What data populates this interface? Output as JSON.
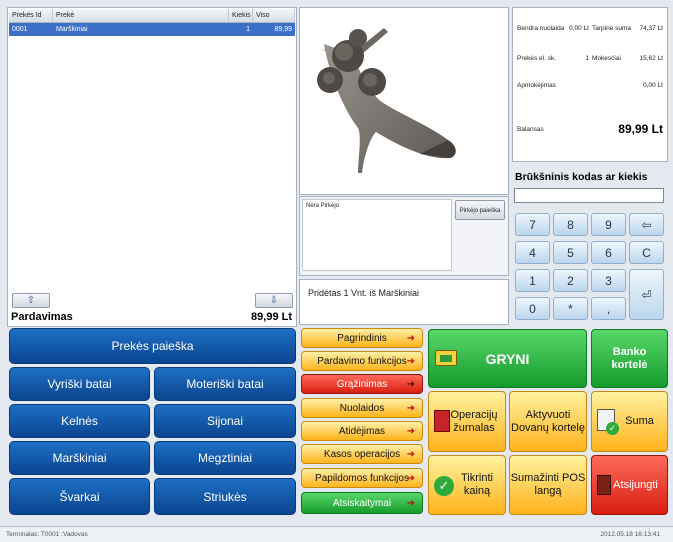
{
  "cart": {
    "columns": [
      "Prekės Id",
      "Prekė",
      "Kiekis",
      "Viso"
    ],
    "rows": [
      [
        "0001",
        "Marškiniai",
        "1",
        "89,99"
      ]
    ],
    "scroll_up": "⇧",
    "scroll_down": "⇩",
    "mode_label": "Pardavimas",
    "total": "89,99 Lt"
  },
  "buyer": {
    "label": "Nėra Pirkėjo",
    "search_button": "Pirkėjo paieška"
  },
  "message": "Pridėtas 1 Vnt. iš Marškiniai",
  "summary": {
    "discount_label": "Bendra nuolaida",
    "discount_value": "0,00 Lt",
    "subtotal_label": "Tarpinė suma",
    "subtotal_value": "74,37 Lt",
    "count_label": "Prekės el. sk.",
    "count_value": "1",
    "tax_label": "Mokesčiai",
    "tax_value": "15,62 Lt",
    "paid_label": "Apmokėjimas",
    "paid_value": "0,00 Lt",
    "balance_label": "Balansas",
    "balance_value": "89,99 Lt"
  },
  "barcode": {
    "label": "Brūkšninis kodas ar kiekis",
    "value": ""
  },
  "numpad": {
    "k7": "7",
    "k8": "8",
    "k9": "9",
    "back": "⇦",
    "k4": "4",
    "k5": "5",
    "k6": "6",
    "clear": "C",
    "k1": "1",
    "k2": "2",
    "k3": "3",
    "enter": "⏎",
    "k0": "0",
    "star": "*",
    "comma": ","
  },
  "categories": {
    "search": "Prekės paieška",
    "men": "Vyriški batai",
    "women": "Moteriški batai",
    "pants": "Kelnės",
    "skirts": "Sijonai",
    "shirts": "Marškiniai",
    "knits": "Megztiniai",
    "jackets": "Švarkai",
    "coats": "Striukės"
  },
  "menu": {
    "main": "Pagrindinis",
    "sales": "Pardavimo funkcijos",
    "returns": "Grąžinimas",
    "discounts": "Nuolaidos",
    "postpone": "Atidėjimas",
    "cash_ops": "Kasos operacijos",
    "extra": "Papildomos funkcijos",
    "reports": "Atsiskaitymai",
    "arrow": "➜"
  },
  "actions": {
    "cash": "GRYNI",
    "card": "Banko kortelė",
    "journal": "Operacijų žurnalas",
    "gift": "Aktyvuoti Dovanų kortelę",
    "sum": "Suma",
    "check_price": "Tikrinti kainą",
    "pos_window": "Sumažinti POS langą",
    "logout": "Atsijungti"
  },
  "status": {
    "terminal": "Terminalas: T0001 :Vadovas",
    "datetime": "2012.05.18 16:13:41"
  },
  "colors": {
    "accent_blue": "#0a4590",
    "cash_green": "#159a2c",
    "logout_red": "#d71e10"
  }
}
